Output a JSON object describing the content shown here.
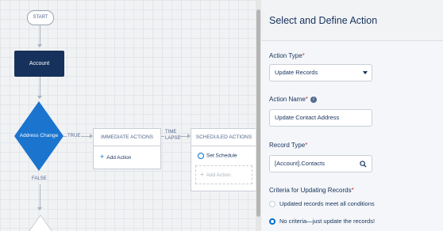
{
  "flow": {
    "start_label": "START",
    "account_label": "Account",
    "decision_label": "Address Change",
    "true_label": "TRUE",
    "false_label": "FALSE",
    "time_lapse_line1": "TIME",
    "time_lapse_line2": "LAPSE",
    "immediate": {
      "title": "IMMEDIATE ACTIONS",
      "add_action": "Add Action"
    },
    "scheduled": {
      "title": "SCHEDULED ACTIONS",
      "set_schedule": "Set Schedule",
      "add_action": "Add Action"
    }
  },
  "panel": {
    "title": "Select and Define Action",
    "action_type": {
      "label": "Action Type",
      "value": "Update Records"
    },
    "action_name": {
      "label": "Action Name",
      "value": "Update Contact Address"
    },
    "record_type": {
      "label": "Record Type",
      "value": "[Account].Contacts"
    },
    "criteria": {
      "label": "Criteria for Updating Records",
      "options": [
        "Updated records meet all conditions",
        "No criteria—just update the records!"
      ],
      "selected": 1
    }
  },
  "colors": {
    "accent": "#0070d2",
    "decision": "#1b75cf",
    "account": "#16325c"
  },
  "icons": [
    "plus-icon",
    "clock-icon",
    "search-icon",
    "info-icon",
    "chevron-down-icon"
  ]
}
